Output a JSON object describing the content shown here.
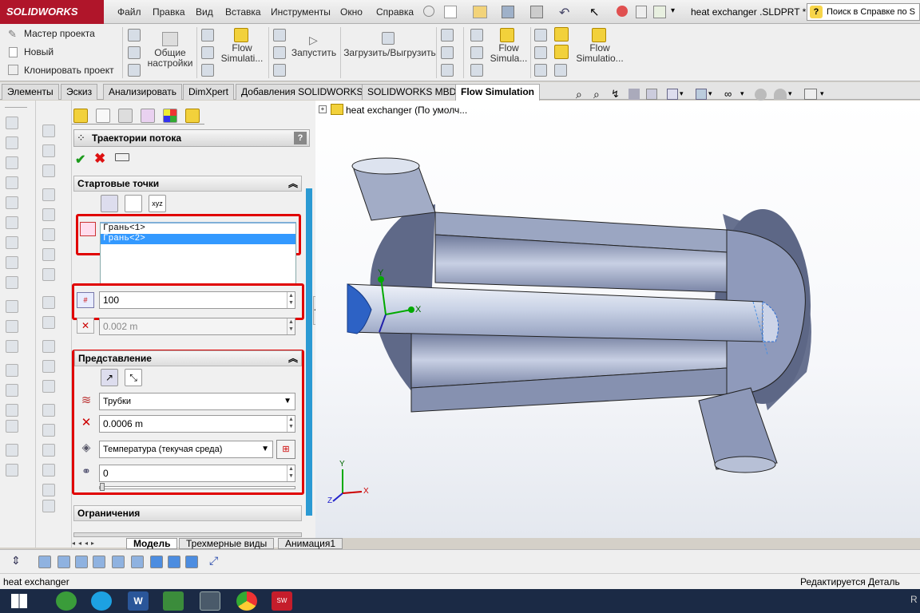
{
  "app": {
    "logo_text": "SOLIDWORKS",
    "file_title": "heat exchanger .SLDPRT *",
    "help_search": "Поиск в Справке по S"
  },
  "menu": [
    "Файл",
    "Правка",
    "Вид",
    "Вставка",
    "Инструменты",
    "Окно",
    "Справка"
  ],
  "ribbon": {
    "small_buttons": [
      "Мастер проекта",
      "Новый",
      "Клонировать проект"
    ],
    "general_settings": "Общие настройки",
    "flow_sim_1": "Flow Simulati...",
    "run": "Запустить",
    "load_unload": "Загрузить/Выгрузить",
    "flow_sim_2": "Flow Simula...",
    "flow_sim_3": "Flow Simulatio..."
  },
  "tabs": [
    "Элементы",
    "Эскиз",
    "Анализировать",
    "DimXpert",
    "Добавления SOLIDWORKS",
    "SOLIDWORKS MBD",
    "Flow Simulation"
  ],
  "tree": {
    "root_label": "heat exchanger  (По умолч..."
  },
  "panel": {
    "title": "Траектории потока",
    "start_points_section": "Стартовые точки",
    "faces": [
      "Грань<1>",
      "Грань<2>"
    ],
    "point_count": "100",
    "step_value": "0.002 m",
    "representation_section": "Представление",
    "draw_as": "Трубки",
    "width_value": "0.0006 m",
    "color_by": "Температура (текучая среда)",
    "transparency": "0",
    "constraints_section": "Ограничения"
  },
  "bottom_tabs": [
    "Модель",
    "Трехмерные виды",
    "Анимация1"
  ],
  "status": {
    "left": "heat exchanger",
    "right": "Редактируется Деталь",
    "far_right": "R"
  },
  "axes": {
    "x": "X",
    "y": "Y",
    "z": "Z"
  }
}
